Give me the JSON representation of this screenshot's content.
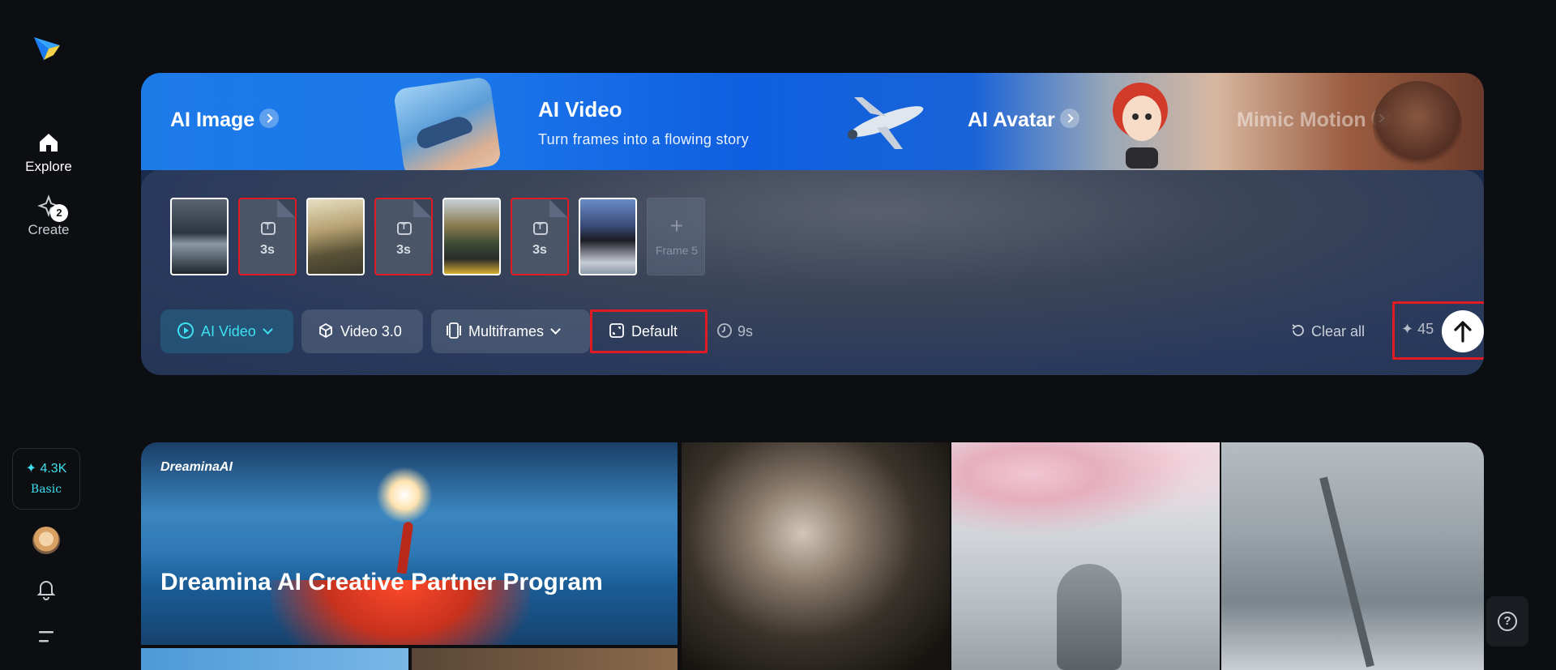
{
  "sidebar": {
    "explore_label": "Explore",
    "create_label": "Create",
    "create_badge": "2",
    "credits": "✦ 4.3K",
    "plan": "Basic"
  },
  "hero": {
    "tabs": {
      "ai_image": "AI Image",
      "ai_video_title": "AI Video",
      "ai_video_subtitle": "Turn frames into a flowing story",
      "ai_avatar": "AI Avatar",
      "mimic_motion": "Mimic Motion"
    },
    "frames": [
      {
        "type": "image",
        "name": "car-photo"
      },
      {
        "type": "text",
        "duration": "3s"
      },
      {
        "type": "image",
        "name": "mountain-road-photo"
      },
      {
        "type": "text",
        "duration": "3s"
      },
      {
        "type": "image",
        "name": "car-road-photo"
      },
      {
        "type": "text",
        "duration": "3s"
      },
      {
        "type": "image",
        "name": "traffic-light-photo"
      }
    ],
    "add_frame_label": "Frame 5",
    "toolbar": {
      "mode": "AI Video",
      "model": "Video 3.0",
      "multiframes": "Multiframes",
      "aspect": "Default",
      "duration": "9s",
      "clear_all": "Clear all",
      "credit_cost": "45"
    }
  },
  "gallery": {
    "banner_brand": "DreaminaAI",
    "banner_title": "Dreamina AI Creative Partner Program"
  },
  "colors": {
    "accent": "#3ee0f0",
    "highlight": "#e01b24",
    "background": "#0c0e11"
  }
}
